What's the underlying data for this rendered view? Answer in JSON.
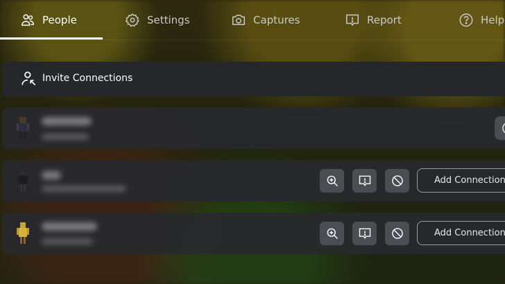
{
  "tabs": [
    {
      "label": "People",
      "icon": "people-icon",
      "active": true
    },
    {
      "label": "Settings",
      "icon": "gear-icon"
    },
    {
      "label": "Captures",
      "icon": "camera-icon"
    },
    {
      "label": "Report",
      "icon": "report-flag-icon"
    },
    {
      "label": "Help",
      "icon": "help-icon"
    }
  ],
  "invite": {
    "label": "Invite Connections",
    "icon": "invite-person-icon"
  },
  "players": [
    {
      "avatar": "player-avatar-1",
      "actions": [
        "more-options-icon"
      ]
    },
    {
      "avatar": "player-avatar-2",
      "actions": [
        "inspect-icon",
        "report-icon",
        "block-icon"
      ],
      "add_label": "Add Connection"
    },
    {
      "avatar": "player-avatar-3",
      "actions": [
        "inspect-icon",
        "report-icon",
        "block-icon"
      ],
      "add_label": "Add Connection"
    }
  ],
  "colors": {
    "panel": "#26272a",
    "button": "#4c4d52",
    "active_tab": "#ffffff",
    "inactive_tab": "#c9c9c9"
  }
}
